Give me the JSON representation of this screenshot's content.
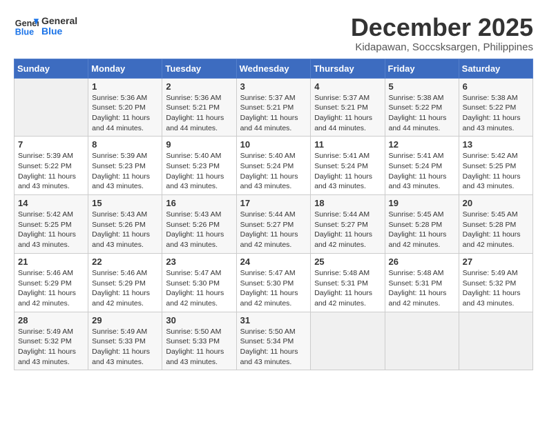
{
  "header": {
    "logo_general": "General",
    "logo_blue": "Blue",
    "month_title": "December 2025",
    "location": "Kidapawan, Soccsksargen, Philippines"
  },
  "days_of_week": [
    "Sunday",
    "Monday",
    "Tuesday",
    "Wednesday",
    "Thursday",
    "Friday",
    "Saturday"
  ],
  "weeks": [
    [
      {
        "day": "",
        "info": ""
      },
      {
        "day": "1",
        "info": "Sunrise: 5:36 AM\nSunset: 5:20 PM\nDaylight: 11 hours\nand 44 minutes."
      },
      {
        "day": "2",
        "info": "Sunrise: 5:36 AM\nSunset: 5:21 PM\nDaylight: 11 hours\nand 44 minutes."
      },
      {
        "day": "3",
        "info": "Sunrise: 5:37 AM\nSunset: 5:21 PM\nDaylight: 11 hours\nand 44 minutes."
      },
      {
        "day": "4",
        "info": "Sunrise: 5:37 AM\nSunset: 5:21 PM\nDaylight: 11 hours\nand 44 minutes."
      },
      {
        "day": "5",
        "info": "Sunrise: 5:38 AM\nSunset: 5:22 PM\nDaylight: 11 hours\nand 44 minutes."
      },
      {
        "day": "6",
        "info": "Sunrise: 5:38 AM\nSunset: 5:22 PM\nDaylight: 11 hours\nand 43 minutes."
      }
    ],
    [
      {
        "day": "7",
        "info": "Sunrise: 5:39 AM\nSunset: 5:22 PM\nDaylight: 11 hours\nand 43 minutes."
      },
      {
        "day": "8",
        "info": "Sunrise: 5:39 AM\nSunset: 5:23 PM\nDaylight: 11 hours\nand 43 minutes."
      },
      {
        "day": "9",
        "info": "Sunrise: 5:40 AM\nSunset: 5:23 PM\nDaylight: 11 hours\nand 43 minutes."
      },
      {
        "day": "10",
        "info": "Sunrise: 5:40 AM\nSunset: 5:24 PM\nDaylight: 11 hours\nand 43 minutes."
      },
      {
        "day": "11",
        "info": "Sunrise: 5:41 AM\nSunset: 5:24 PM\nDaylight: 11 hours\nand 43 minutes."
      },
      {
        "day": "12",
        "info": "Sunrise: 5:41 AM\nSunset: 5:24 PM\nDaylight: 11 hours\nand 43 minutes."
      },
      {
        "day": "13",
        "info": "Sunrise: 5:42 AM\nSunset: 5:25 PM\nDaylight: 11 hours\nand 43 minutes."
      }
    ],
    [
      {
        "day": "14",
        "info": "Sunrise: 5:42 AM\nSunset: 5:25 PM\nDaylight: 11 hours\nand 43 minutes."
      },
      {
        "day": "15",
        "info": "Sunrise: 5:43 AM\nSunset: 5:26 PM\nDaylight: 11 hours\nand 43 minutes."
      },
      {
        "day": "16",
        "info": "Sunrise: 5:43 AM\nSunset: 5:26 PM\nDaylight: 11 hours\nand 43 minutes."
      },
      {
        "day": "17",
        "info": "Sunrise: 5:44 AM\nSunset: 5:27 PM\nDaylight: 11 hours\nand 42 minutes."
      },
      {
        "day": "18",
        "info": "Sunrise: 5:44 AM\nSunset: 5:27 PM\nDaylight: 11 hours\nand 42 minutes."
      },
      {
        "day": "19",
        "info": "Sunrise: 5:45 AM\nSunset: 5:28 PM\nDaylight: 11 hours\nand 42 minutes."
      },
      {
        "day": "20",
        "info": "Sunrise: 5:45 AM\nSunset: 5:28 PM\nDaylight: 11 hours\nand 42 minutes."
      }
    ],
    [
      {
        "day": "21",
        "info": "Sunrise: 5:46 AM\nSunset: 5:29 PM\nDaylight: 11 hours\nand 42 minutes."
      },
      {
        "day": "22",
        "info": "Sunrise: 5:46 AM\nSunset: 5:29 PM\nDaylight: 11 hours\nand 42 minutes."
      },
      {
        "day": "23",
        "info": "Sunrise: 5:47 AM\nSunset: 5:30 PM\nDaylight: 11 hours\nand 42 minutes."
      },
      {
        "day": "24",
        "info": "Sunrise: 5:47 AM\nSunset: 5:30 PM\nDaylight: 11 hours\nand 42 minutes."
      },
      {
        "day": "25",
        "info": "Sunrise: 5:48 AM\nSunset: 5:31 PM\nDaylight: 11 hours\nand 42 minutes."
      },
      {
        "day": "26",
        "info": "Sunrise: 5:48 AM\nSunset: 5:31 PM\nDaylight: 11 hours\nand 42 minutes."
      },
      {
        "day": "27",
        "info": "Sunrise: 5:49 AM\nSunset: 5:32 PM\nDaylight: 11 hours\nand 43 minutes."
      }
    ],
    [
      {
        "day": "28",
        "info": "Sunrise: 5:49 AM\nSunset: 5:32 PM\nDaylight: 11 hours\nand 43 minutes."
      },
      {
        "day": "29",
        "info": "Sunrise: 5:49 AM\nSunset: 5:33 PM\nDaylight: 11 hours\nand 43 minutes."
      },
      {
        "day": "30",
        "info": "Sunrise: 5:50 AM\nSunset: 5:33 PM\nDaylight: 11 hours\nand 43 minutes."
      },
      {
        "day": "31",
        "info": "Sunrise: 5:50 AM\nSunset: 5:34 PM\nDaylight: 11 hours\nand 43 minutes."
      },
      {
        "day": "",
        "info": ""
      },
      {
        "day": "",
        "info": ""
      },
      {
        "day": "",
        "info": ""
      }
    ]
  ]
}
